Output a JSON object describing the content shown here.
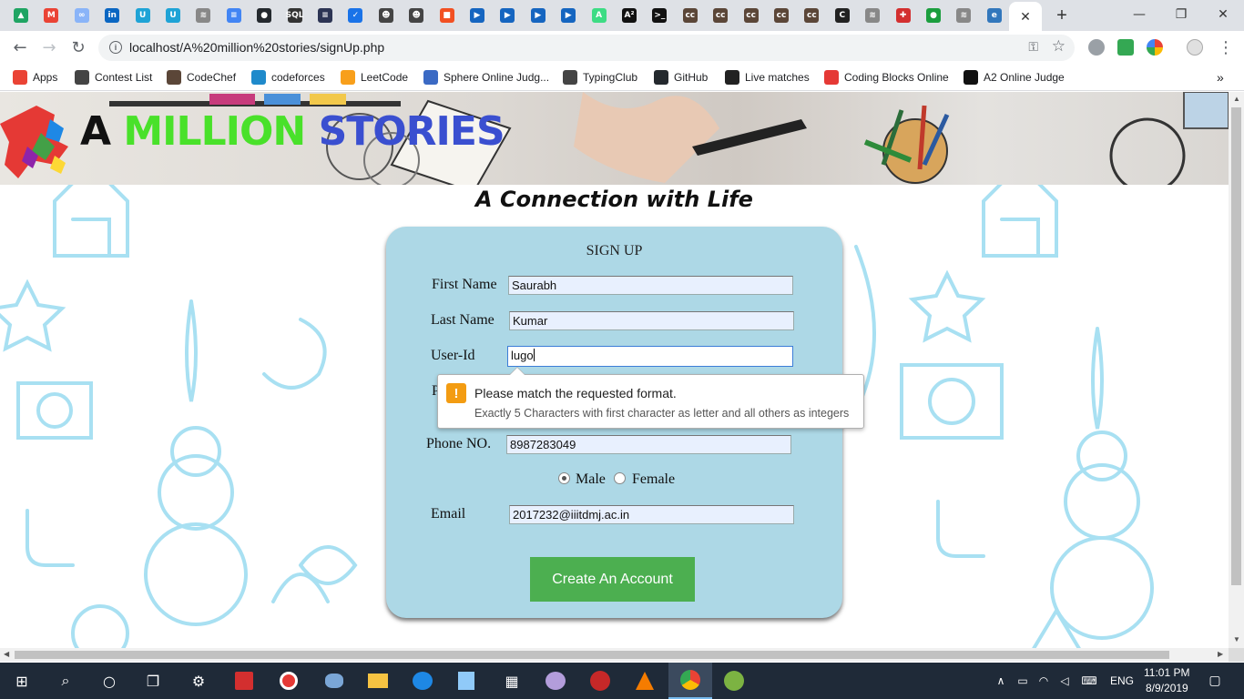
{
  "browser": {
    "active_tab_close": "✕",
    "new_tab": "+",
    "window_controls": {
      "minimize": "—",
      "maximize": "❐",
      "close": "✕"
    },
    "url": "localhost/A%20million%20stories/signUp.php",
    "tab_favicons": [
      {
        "icon": "google-drive-icon",
        "color": "#1fa463",
        "glyph": "▲"
      },
      {
        "icon": "gmail-icon",
        "color": "#ea4335",
        "glyph": "M"
      },
      {
        "icon": "link-icon",
        "color": "#8ab4f8",
        "glyph": "∞"
      },
      {
        "icon": "linkedin-icon",
        "color": "#0a66c2",
        "glyph": "in"
      },
      {
        "icon": "udemy-icon",
        "color": "#1ea3d6",
        "glyph": "U"
      },
      {
        "icon": "udemy-icon",
        "color": "#1ea3d6",
        "glyph": "U"
      },
      {
        "icon": "stack-icon",
        "color": "#888888",
        "glyph": "≋"
      },
      {
        "icon": "docs-icon",
        "color": "#4285f4",
        "glyph": "≡"
      },
      {
        "icon": "github-icon",
        "color": "#24292e",
        "glyph": "●"
      },
      {
        "icon": "sql-icon",
        "color": "#333333",
        "glyph": "SQL"
      },
      {
        "icon": "hackerearth-icon",
        "color": "#2c3454",
        "glyph": "≡"
      },
      {
        "icon": "check-icon",
        "color": "#1a73e8",
        "glyph": "✓"
      },
      {
        "icon": "typingclub-icon",
        "color": "#444444",
        "glyph": "☻"
      },
      {
        "icon": "typingclub-icon",
        "color": "#444444",
        "glyph": "☻"
      },
      {
        "icon": "microsoft-icon",
        "color": "#f25022",
        "glyph": "■"
      },
      {
        "icon": "video-icon",
        "color": "#1565c0",
        "glyph": "▶"
      },
      {
        "icon": "video-icon",
        "color": "#1565c0",
        "glyph": "▶"
      },
      {
        "icon": "video-icon",
        "color": "#1565c0",
        "glyph": "▶"
      },
      {
        "icon": "video-icon",
        "color": "#1565c0",
        "glyph": "▶"
      },
      {
        "icon": "android-icon",
        "color": "#3ddc84",
        "glyph": "A"
      },
      {
        "icon": "a2-icon",
        "color": "#111111",
        "glyph": "A²"
      },
      {
        "icon": "terminal-icon",
        "color": "#111111",
        "glyph": ">_"
      },
      {
        "icon": "codechef-icon",
        "color": "#5b4638",
        "glyph": "cc"
      },
      {
        "icon": "codechef-icon",
        "color": "#5b4638",
        "glyph": "cc"
      },
      {
        "icon": "codechef-icon",
        "color": "#5b4638",
        "glyph": "cc"
      },
      {
        "icon": "codechef-icon",
        "color": "#5b4638",
        "glyph": "cc"
      },
      {
        "icon": "codechef-icon",
        "color": "#5b4638",
        "glyph": "cc"
      },
      {
        "icon": "c-icon",
        "color": "#222222",
        "glyph": "C"
      },
      {
        "icon": "stack-icon",
        "color": "#888888",
        "glyph": "≋"
      },
      {
        "icon": "plus-icon",
        "color": "#d32f2f",
        "glyph": "✚"
      },
      {
        "icon": "leaf-icon",
        "color": "#1b9e3e",
        "glyph": "●"
      },
      {
        "icon": "stack-icon",
        "color": "#888888",
        "glyph": "≋"
      },
      {
        "icon": "edge-icon",
        "color": "#3277bc",
        "glyph": "e"
      }
    ]
  },
  "bookmarks": [
    {
      "label": "Apps",
      "icon": "apps-grid-icon",
      "color": "#ea4335"
    },
    {
      "label": "Contest List",
      "icon": "contest-icon",
      "color": "#444444"
    },
    {
      "label": "CodeChef",
      "icon": "codechef-icon",
      "color": "#5b4638"
    },
    {
      "label": "codeforces",
      "icon": "codeforces-icon",
      "color": "#1f8acb"
    },
    {
      "label": "LeetCode",
      "icon": "leetcode-icon",
      "color": "#f89f1b"
    },
    {
      "label": "Sphere Online Judg...",
      "icon": "spoj-icon",
      "color": "#3b6ac4"
    },
    {
      "label": "TypingClub",
      "icon": "typingclub-icon",
      "color": "#444444"
    },
    {
      "label": "GitHub",
      "icon": "github-icon",
      "color": "#24292e"
    },
    {
      "label": "Live matches",
      "icon": "tv-icon",
      "color": "#222222"
    },
    {
      "label": "Coding Blocks Online",
      "icon": "codingblocks-icon",
      "color": "#e53935"
    },
    {
      "label": "A2 Online Judge",
      "icon": "a2-icon",
      "color": "#111111"
    }
  ],
  "page": {
    "logo": {
      "a": "A",
      "million": "MILLION",
      "stories": "STORIES"
    },
    "tagline": "A Connection with Life",
    "form": {
      "title": "SIGN UP",
      "first_name_label": "First Name",
      "first_name_value": "Saurabh",
      "last_name_label": "Last Name",
      "last_name_value": "Kumar",
      "userid_label": "User-Id",
      "userid_value": "lugo",
      "hidden_label_fragment": "P",
      "phone_label": "Phone NO.",
      "phone_value": "8987283049",
      "gender_male": "Male",
      "gender_female": "Female",
      "gender_selected": "Male",
      "email_label": "Email",
      "email_value": "2017232@iiitdmj.ac.in",
      "submit_label": "Create An Account"
    },
    "tooltip": {
      "icon": "!",
      "message": "Please match the requested format.",
      "detail": "Exactly 5 Characters with first character as letter and all others as integers"
    }
  },
  "taskbar": {
    "time": "11:01 PM",
    "date": "8/9/2019",
    "language": "ENG"
  }
}
